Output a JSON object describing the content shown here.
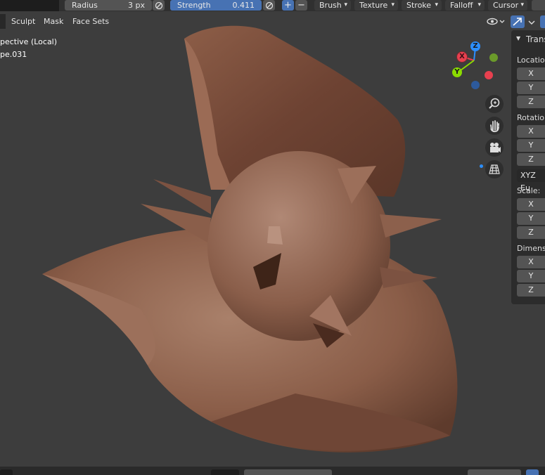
{
  "toolbar": {
    "radius_label": "Radius",
    "radius_value": "3 px",
    "strength_label": "Strength",
    "strength_value": "0.411",
    "plus_icon": "+",
    "minus_icon": "−",
    "menus": [
      "Brush",
      "Texture",
      "Stroke",
      "Falloff",
      "Cursor"
    ]
  },
  "viewport_header": {
    "menus": [
      "Sculpt",
      "Mask",
      "Face Sets"
    ]
  },
  "overlay": {
    "view_name": "pective (Local)",
    "object_name": "pe.031"
  },
  "gizmo": {
    "x_label": "X",
    "y_label": "Y",
    "z_label": "Z",
    "colors": {
      "x": "#e8404f",
      "y": "#8bdc00",
      "z": "#2c8fff"
    }
  },
  "nav_icons": [
    "zoom-icon",
    "hand-pan-icon",
    "camera-icon",
    "grid-icon"
  ],
  "npanel": {
    "header": "Trans",
    "location_label": "Location",
    "rotation_label": "Rotation",
    "rotation_mode": "XYZ Eu",
    "scale_label": "Scale:",
    "dimensions_label": "Dimensi",
    "axis_x": "X",
    "axis_y": "Y",
    "axis_z": "Z"
  }
}
